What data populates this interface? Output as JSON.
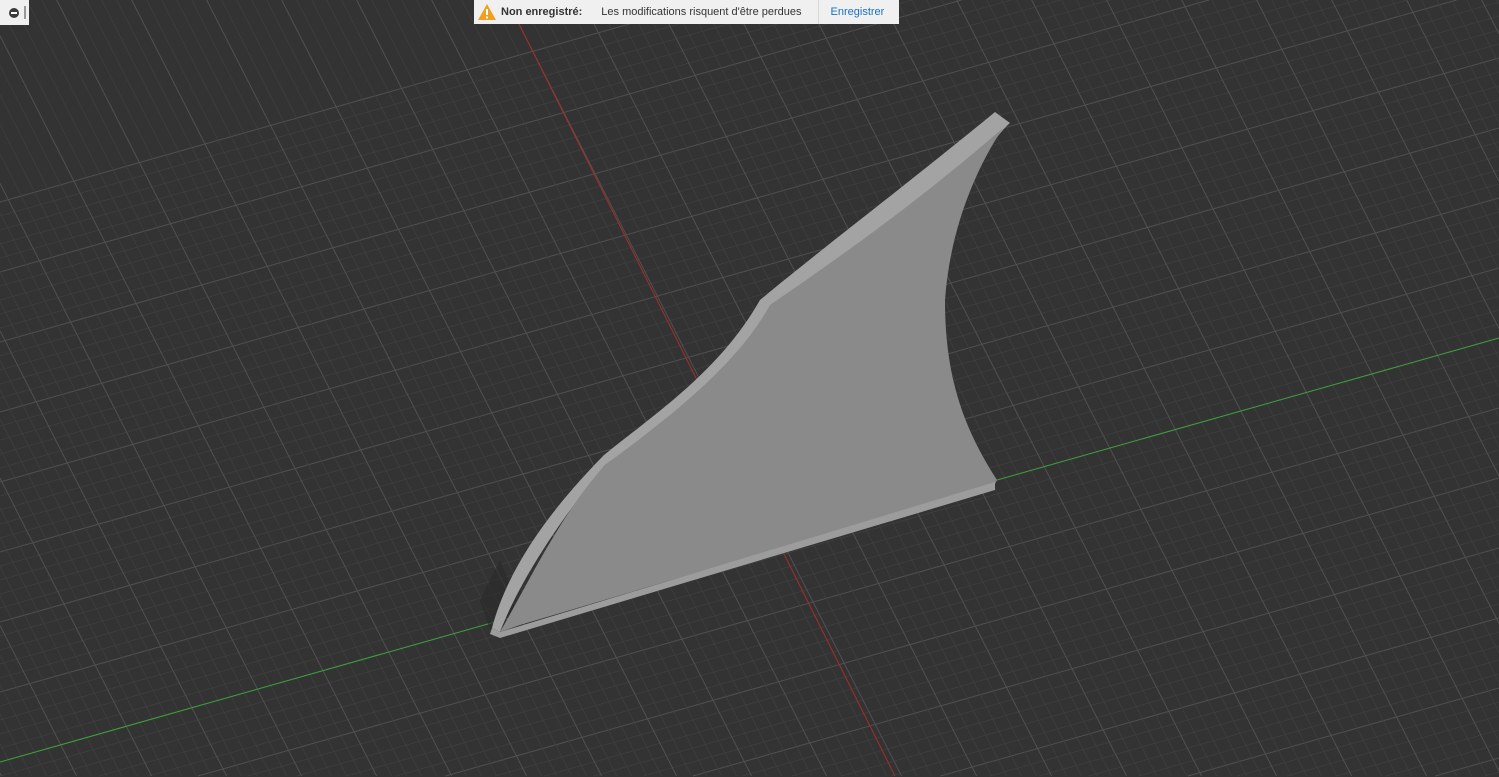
{
  "notification": {
    "title": "Non enregistré:",
    "message": "Les modifications risquent d'être perdues",
    "action_label": "Enregistrer",
    "icon": "warning-icon"
  },
  "colors": {
    "background": "#333333",
    "grid": "#4a4a4a",
    "x_axis": "#3aa03a",
    "y_axis": "#b03030",
    "model_face": "#8c8c8c",
    "model_edge": "#a3a3a3",
    "link": "#1a72bb",
    "warning": "#f0a020"
  }
}
